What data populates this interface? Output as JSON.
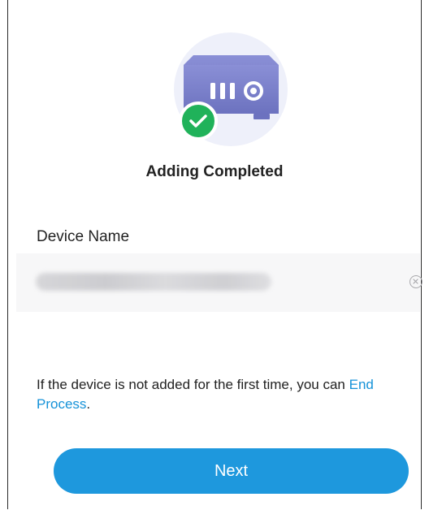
{
  "title": "Adding Completed",
  "device_name": {
    "label": "Device Name",
    "value": ""
  },
  "note": {
    "text": "If the device is not added for the first time, you can",
    "link_label": "End Process",
    "suffix": "."
  },
  "next_label": "Next",
  "colors": {
    "accent": "#1e98dd",
    "link": "#1592d8",
    "success": "#20b25a",
    "device": "#7a7fc8"
  },
  "icons": [
    "nvr-device-icon",
    "check-circle-icon",
    "clear-icon"
  ]
}
